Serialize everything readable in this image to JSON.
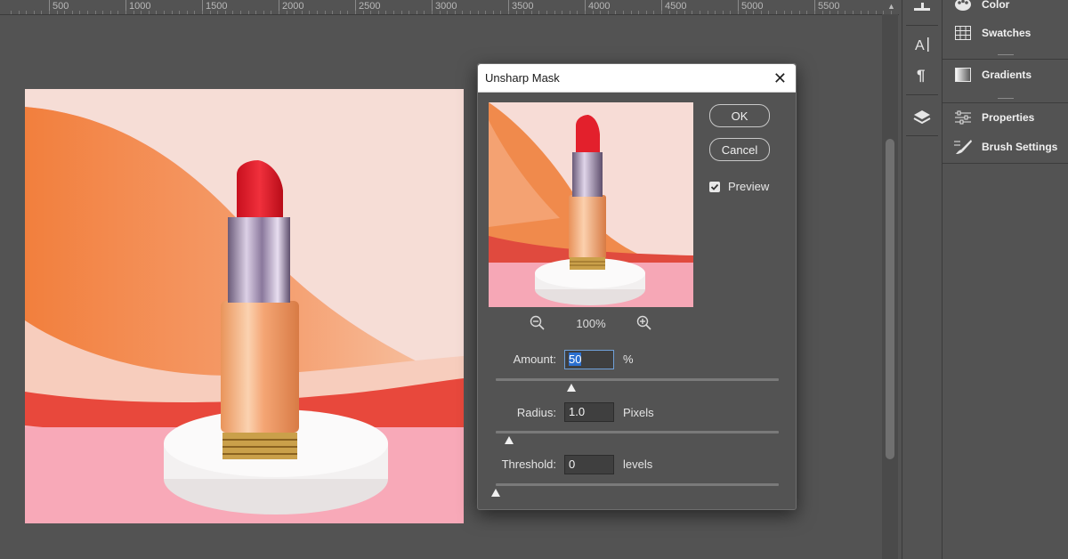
{
  "ruler": {
    "ticks": [
      "500",
      "1000",
      "1500",
      "2000",
      "2500",
      "3000",
      "3500",
      "4000",
      "4500",
      "5000",
      "5500"
    ]
  },
  "panel": {
    "items": [
      {
        "label": "Color",
        "icon": "color-palette-icon"
      },
      {
        "label": "Swatches",
        "icon": "swatches-grid-icon"
      },
      {
        "label": "Gradients",
        "icon": "gradient-icon"
      },
      {
        "label": "Properties",
        "icon": "properties-sliders-icon"
      },
      {
        "label": "Brush Settings",
        "icon": "brush-settings-icon"
      }
    ]
  },
  "iconbar": {
    "icons": [
      "adjust-icon",
      "character-icon",
      "paragraph-icon",
      "layers-icon"
    ]
  },
  "dialog": {
    "title": "Unsharp Mask",
    "ok_label": "OK",
    "cancel_label": "Cancel",
    "preview_label": "Preview",
    "preview_checked": true,
    "zoom_level": "100%",
    "amount": {
      "label": "Amount:",
      "value": "50",
      "unit": "%"
    },
    "radius": {
      "label": "Radius:",
      "value": "1.0",
      "unit": "Pixels"
    },
    "threshold": {
      "label": "Threshold:",
      "value": "0",
      "unit": "levels"
    }
  },
  "colors": {
    "workspace": "#535353",
    "selection_highlight": "#2a6fd0"
  }
}
